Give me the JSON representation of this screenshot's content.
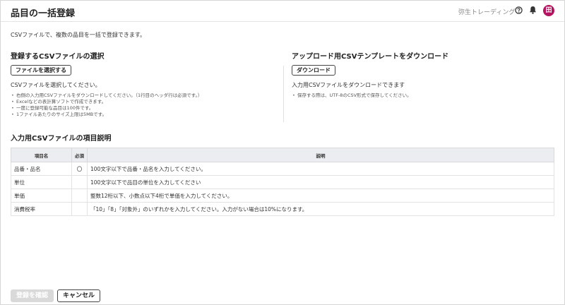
{
  "header": {
    "title": "品目の一括登録",
    "company": "弥生トレーディング",
    "avatar_text": "田"
  },
  "intro": "CSVファイルで、複数の品目を一括で登録できます。",
  "upload": {
    "title": "登録するCSVファイルの選択",
    "button": "ファイルを選択する",
    "prompt": "CSVファイルを選択してください。",
    "bullets": [
      "右側の入力用CSVファイルをダウンロードしてください。（1行目のヘッダ行は必須です。）",
      "Excelなどの表計算ソフトで作成できます。",
      "一度に登録可能な品目は100件です。",
      "1ファイルあたりのサイズ上限は5MBです。"
    ]
  },
  "download": {
    "title": "アップロード用CSVテンプレートをダウンロード",
    "button": "ダウンロード",
    "prompt": "入力用CSVファイルをダウンロードできます",
    "bullets": [
      "保存する際は、UTF-8のCSV形式で保存してください。"
    ]
  },
  "spec": {
    "title": "入力用CSVファイルの項目説明",
    "headers": [
      "項目名",
      "必須",
      "説明"
    ],
    "rows": [
      [
        "品番・品名",
        "〇",
        "100文字以下で品番・品名を入力してください。"
      ],
      [
        "単位",
        "",
        "100文字以下で品目の単位を入力してください"
      ],
      [
        "単価",
        "",
        "整数12桁以下、小数点以下4桁で単価を入力してください。"
      ],
      [
        "消費税率",
        "",
        "「10」「8」「対象外」のいずれかを入力してください。入力がない場合は10%になります。"
      ]
    ]
  },
  "footer": {
    "confirm": "登録を確認",
    "cancel": "キャンセル"
  },
  "colors": {
    "avatar_bg": "#b3135f",
    "table_header_bg": "#ebedf0",
    "disabled_button_bg": "#d9d9d9"
  }
}
